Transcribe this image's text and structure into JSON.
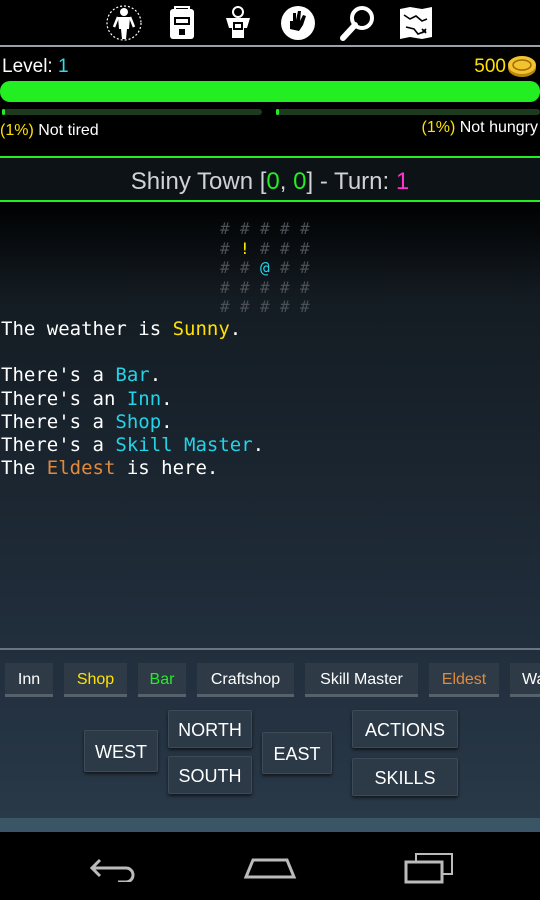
{
  "icon_bar": {
    "icons": [
      "character-icon",
      "inventory-icon",
      "equipment-icon",
      "hand-icon",
      "search-icon",
      "map-icon"
    ]
  },
  "status": {
    "level_label": "Level: ",
    "level_value": "1",
    "gold": "500",
    "tired_pct": "(1%)",
    "tired_text": " Not tired",
    "hungry_pct": "(1%)",
    "hungry_text": " Not hungry",
    "xp_fill_fraction": 1.0,
    "tired_fill_fraction": 0.01,
    "hungry_fill_fraction": 0.01
  },
  "location": {
    "name": "Shiny Town ",
    "bracket_open": "[",
    "x": "0",
    "comma": ", ",
    "y": "0",
    "bracket_close": "]",
    "turn_label": " - Turn: ",
    "turn": "1"
  },
  "map": {
    "rows": [
      [
        "#",
        "#",
        "#",
        "#",
        "#"
      ],
      [
        "#",
        "!",
        "#",
        "#",
        "#"
      ],
      [
        "#",
        "#",
        "@",
        "#",
        "#"
      ],
      [
        "#",
        "#",
        "#",
        "#",
        "#"
      ],
      [
        "#",
        "#",
        "#",
        "#",
        "#"
      ]
    ]
  },
  "log": {
    "weather_prefix": "The weather is ",
    "weather": "Sunny",
    "weather_suffix": ".",
    "line1_prefix": "There's a ",
    "line1_place": "Bar",
    "line2_prefix": "There's an ",
    "line2_place": "Inn",
    "line3_prefix": "There's a ",
    "line3_place": "Shop",
    "line4_prefix": "There's a ",
    "line4_place": "Skill Master",
    "line5_prefix": "The ",
    "line5_person": "Eldest",
    "line5_suffix": " is here.",
    "period": "."
  },
  "tabs": [
    "Inn",
    "Shop",
    "Bar",
    "Craftshop",
    "Skill Master",
    "Eldest",
    "Wa"
  ],
  "controls": {
    "north": "NORTH",
    "south": "SOUTH",
    "west": "WEST",
    "east": "EAST",
    "actions": "ACTIONS",
    "skills": "SKILLS"
  },
  "navbar": {
    "icons": [
      "back-icon",
      "home-icon",
      "recent-apps-icon"
    ]
  },
  "colors": {
    "green": "#22ee22",
    "cyan": "#22d4e8",
    "yellow": "#ffe100",
    "orange": "#e08a3c",
    "magenta": "#ff33cc"
  }
}
